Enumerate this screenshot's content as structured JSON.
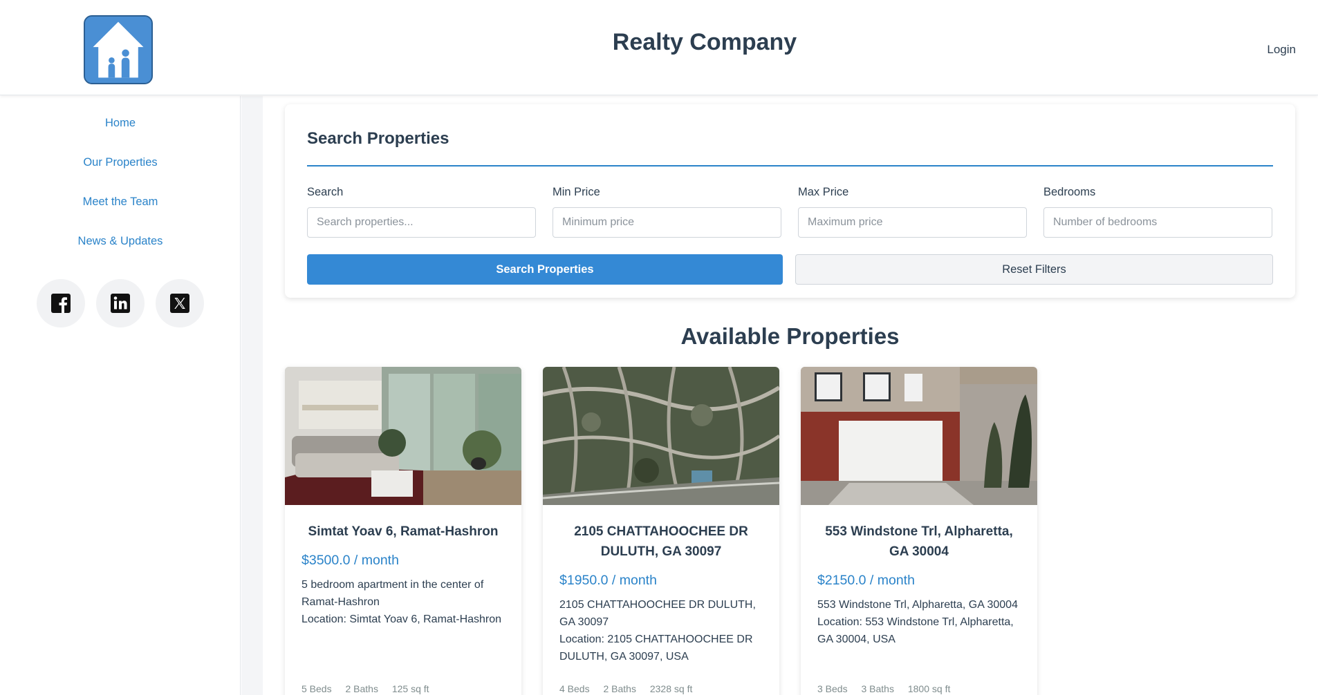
{
  "header": {
    "title": "Realty Company",
    "login_label": "Login",
    "logo_icon": "house-family-logo"
  },
  "sidebar": {
    "items": [
      {
        "label": "Home"
      },
      {
        "label": "Our Properties"
      },
      {
        "label": "Meet the Team"
      },
      {
        "label": "News & Updates"
      }
    ],
    "social": [
      {
        "icon": "facebook-icon"
      },
      {
        "icon": "linkedin-icon"
      },
      {
        "icon": "x-icon"
      }
    ]
  },
  "search": {
    "title": "Search Properties",
    "fields": [
      {
        "label": "Search",
        "placeholder": "Search properties..."
      },
      {
        "label": "Min Price",
        "placeholder": "Minimum price"
      },
      {
        "label": "Max Price",
        "placeholder": "Maximum price"
      },
      {
        "label": "Bedrooms",
        "placeholder": "Number of bedrooms"
      }
    ],
    "search_button": "Search Properties",
    "reset_button": "Reset Filters"
  },
  "listings": {
    "title": "Available Properties",
    "cards": [
      {
        "title": "Simtat Yoav 6, Ramat-Hashron",
        "price": "$3500.0 / month",
        "description": "5 bedroom apartment in the center of Ramat-Hashron",
        "location": "Location: Simtat Yoav 6, Ramat-Hashron",
        "beds": "5 Beds",
        "baths": "2 Baths",
        "area": "125 sq ft"
      },
      {
        "title": "2105 CHATTAHOOCHEE DR DULUTH, GA 30097",
        "price": "$1950.0 / month",
        "description": "2105 CHATTAHOOCHEE DR DULUTH, GA 30097",
        "location": "Location: 2105 CHATTAHOOCHEE DR DULUTH, GA 30097, USA",
        "beds": "4 Beds",
        "baths": "2 Baths",
        "area": "2328 sq ft"
      },
      {
        "title": "553 Windstone Trl, Alpharetta, GA 30004",
        "price": "$2150.0 / month",
        "description": "553 Windstone Trl, Alpharetta, GA 30004",
        "location": "Location: 553 Windstone Trl, Alpharetta, GA 30004, USA",
        "beds": "3 Beds",
        "baths": "3 Baths",
        "area": "1800 sq ft"
      }
    ]
  },
  "colors": {
    "accent": "#2a83c9",
    "primary_button": "#3489d5",
    "heading": "#2c3e50"
  }
}
